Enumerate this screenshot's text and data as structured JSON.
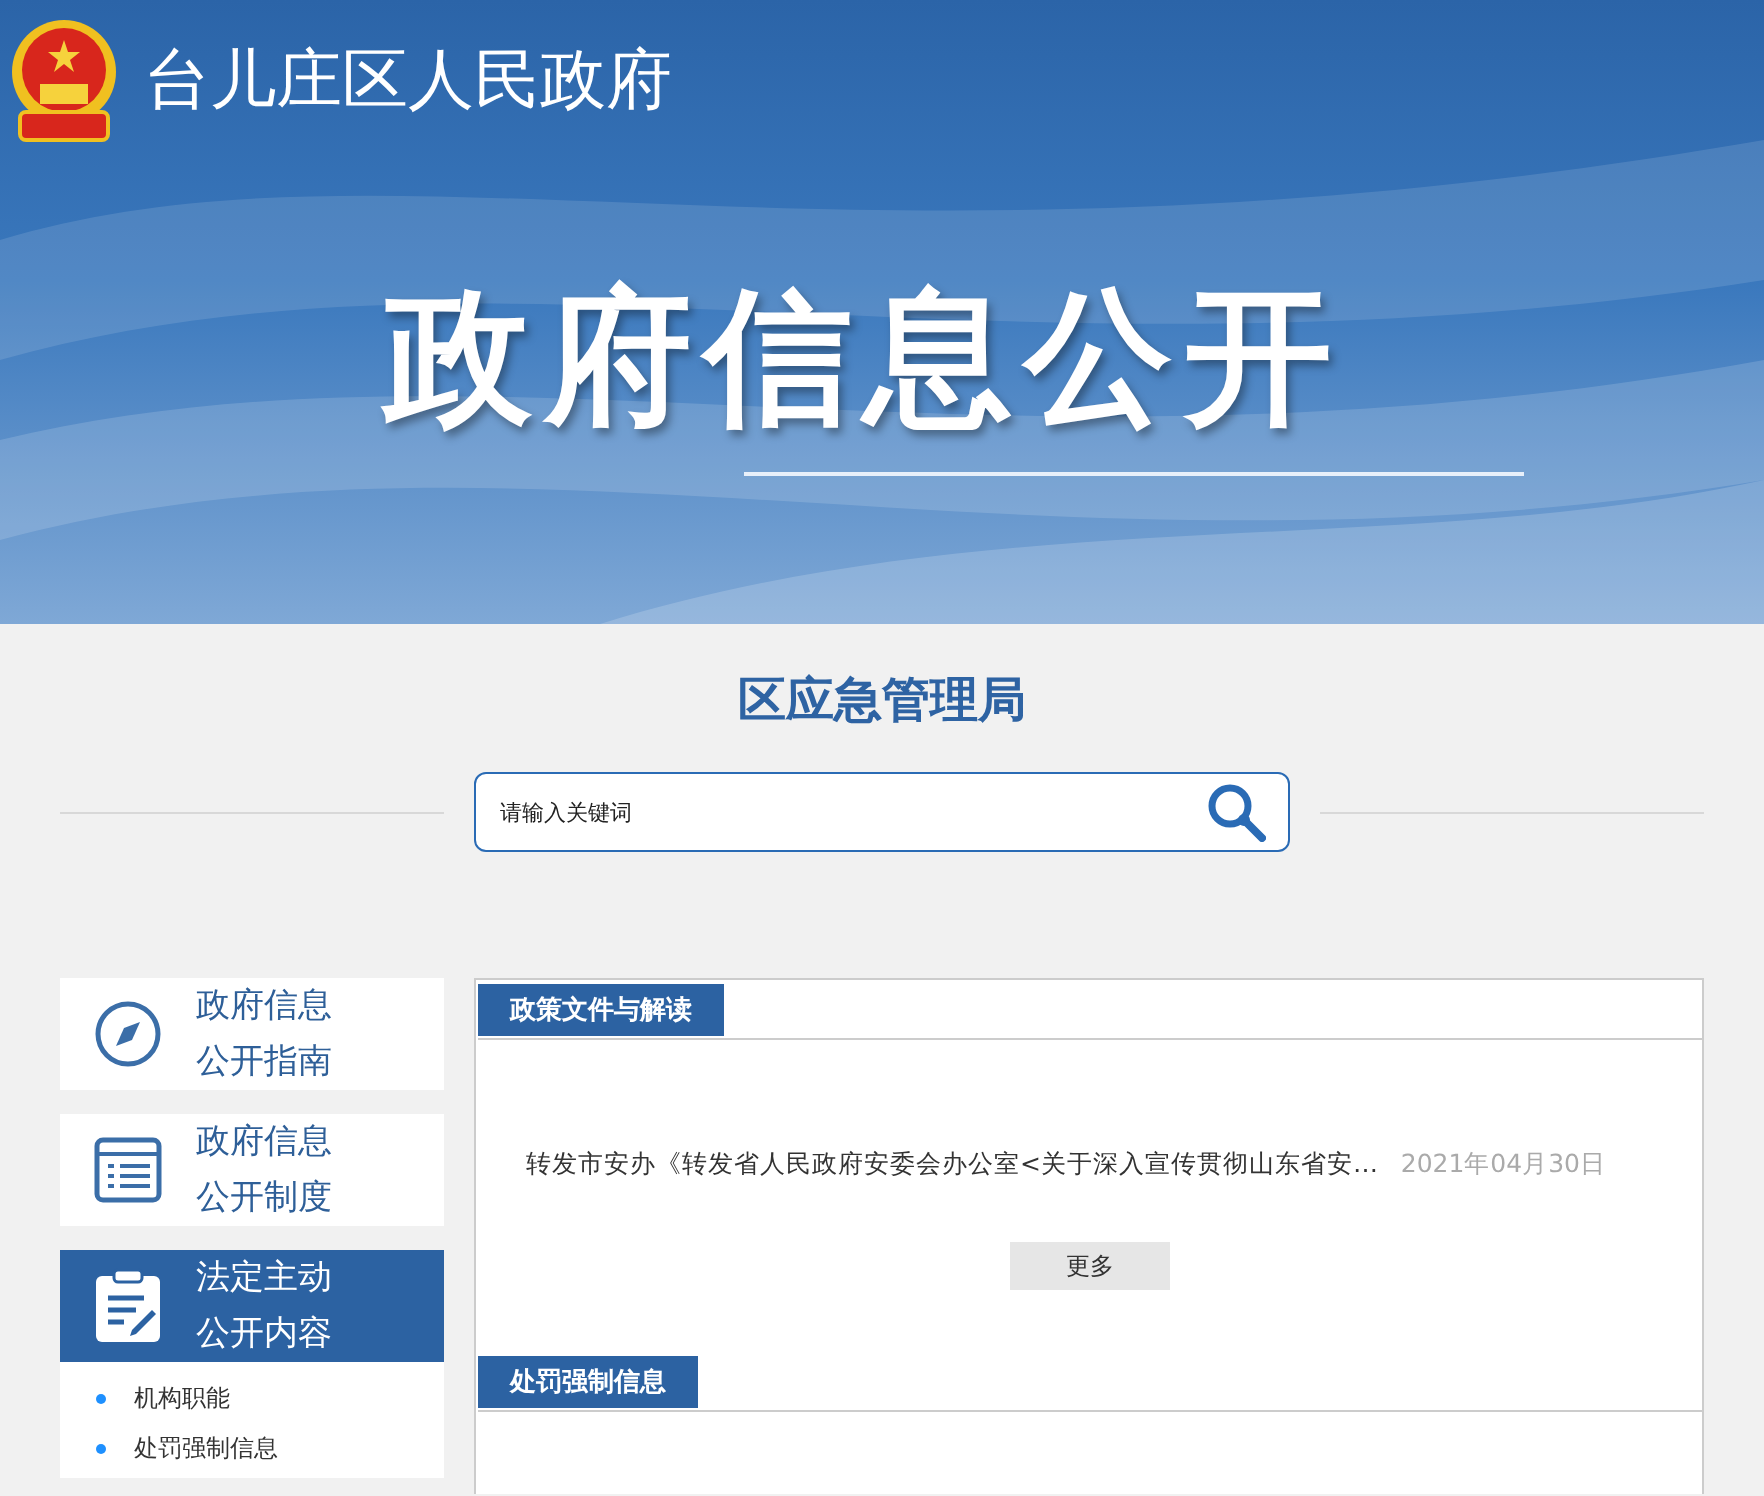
{
  "header": {
    "site_title": "台儿庄区人民政府",
    "banner_title": "政府信息公开"
  },
  "department": "区应急管理局",
  "search": {
    "placeholder": "请输入关键词"
  },
  "sidebar": {
    "items": [
      {
        "label": "政府信息公开指南",
        "selected": false
      },
      {
        "label": "政府信息公开制度",
        "selected": false
      },
      {
        "label": "法定主动公开内容",
        "selected": true
      }
    ],
    "sub_items": [
      "机构职能",
      "处罚强制信息"
    ]
  },
  "sections": [
    {
      "title": "政策文件与解读",
      "rows": [
        {
          "title": "转发市安办《转发省人民政府安委会办公室<关于深入宣传贯彻山东省安…",
          "date": "2021年04月30日"
        }
      ],
      "more": "更多"
    },
    {
      "title": "处罚强制信息"
    }
  ]
}
